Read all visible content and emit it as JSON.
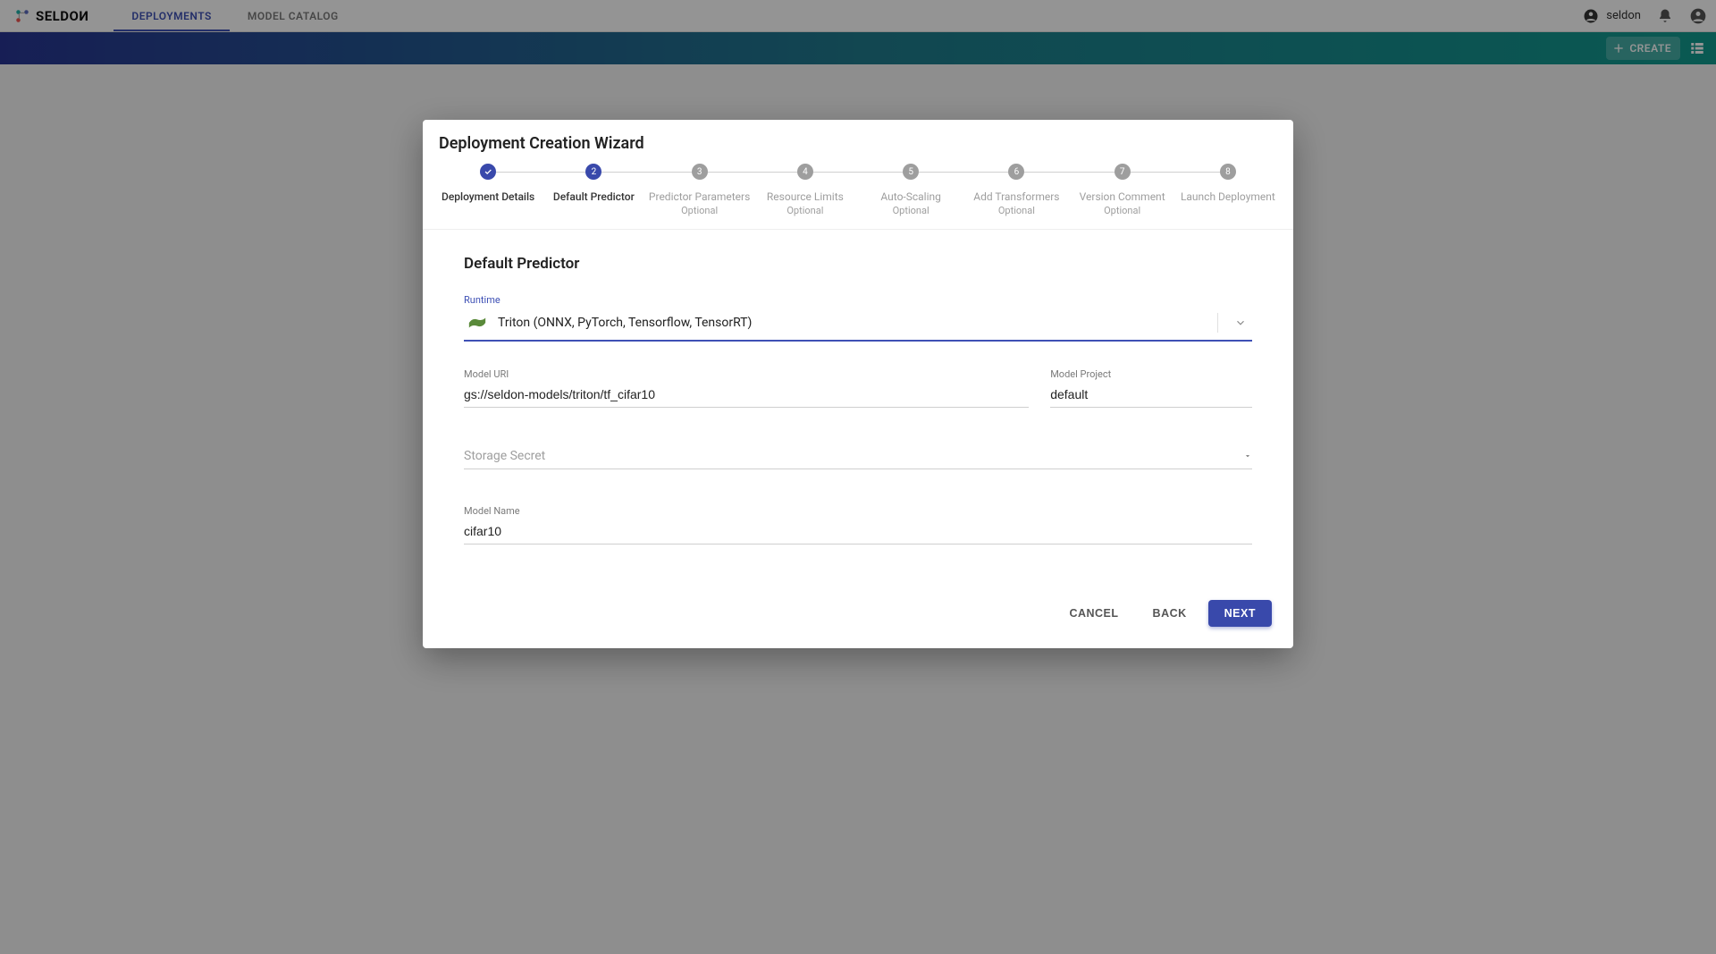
{
  "brand": {
    "name": "SELDOИ"
  },
  "nav": {
    "tabs": [
      {
        "label": "DEPLOYMENTS",
        "active": true
      },
      {
        "label": "MODEL CATALOG",
        "active": false
      }
    ]
  },
  "user": {
    "name": "seldon"
  },
  "secondbar": {
    "create_label": "CREATE"
  },
  "modal": {
    "title": "Deployment Creation Wizard",
    "steps": [
      {
        "num": "1",
        "label": "Deployment Details",
        "state": "done",
        "optional": false
      },
      {
        "num": "2",
        "label": "Default Predictor",
        "state": "active",
        "optional": false
      },
      {
        "num": "3",
        "label": "Predictor Parameters",
        "state": "pending",
        "optional": true
      },
      {
        "num": "4",
        "label": "Resource Limits",
        "state": "pending",
        "optional": true
      },
      {
        "num": "5",
        "label": "Auto-Scaling",
        "state": "pending",
        "optional": true
      },
      {
        "num": "6",
        "label": "Add Transformers",
        "state": "pending",
        "optional": true
      },
      {
        "num": "7",
        "label": "Version Comment",
        "state": "pending",
        "optional": true
      },
      {
        "num": "8",
        "label": "Launch Deployment",
        "state": "pending",
        "optional": false
      }
    ],
    "optional_text": "Optional",
    "section_title": "Default Predictor",
    "form": {
      "runtime_label": "Runtime",
      "runtime_value": "Triton (ONNX, PyTorch, Tensorflow, TensorRT)",
      "model_uri_label": "Model URI",
      "model_uri_value": "gs://seldon-models/triton/tf_cifar10",
      "model_project_label": "Model Project",
      "model_project_value": "default",
      "storage_secret_label": "Storage Secret",
      "storage_secret_value": "",
      "model_name_label": "Model Name",
      "model_name_value": "cifar10"
    },
    "buttons": {
      "cancel": "CANCEL",
      "back": "BACK",
      "next": "NEXT"
    }
  }
}
